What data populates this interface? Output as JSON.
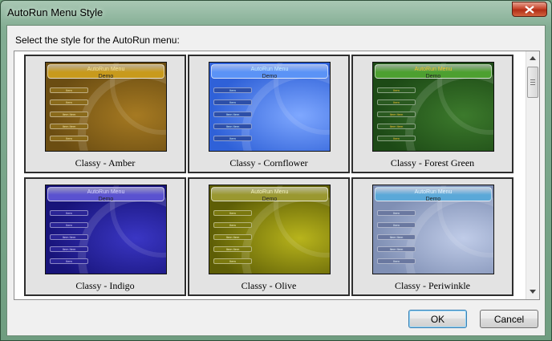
{
  "window": {
    "title": "AutoRun Menu Style"
  },
  "prompt": "Select the style for the AutoRun menu:",
  "preview": {
    "header_title": "AutoRun Menu",
    "header_sub": "Demo",
    "buttons": [
      "Item",
      "Item",
      "Item Item",
      "Item Item",
      "Item"
    ]
  },
  "styles": [
    {
      "caption": "Classy - Amber",
      "bg": "#6b4d12",
      "bg2": "#a67a22",
      "head": "#c89a1c",
      "head_text": "#f2e3a0",
      "btn": "#8a6a1a",
      "selected": false
    },
    {
      "caption": "Classy - Cornflower",
      "bg": "#2f61d8",
      "bg2": "#7fa8ff",
      "head": "#5b93f6",
      "head_text": "#c8f0ff",
      "btn": "#2d4fa8",
      "selected": false
    },
    {
      "caption": "Classy - Forest Green",
      "bg": "#1d4a16",
      "bg2": "#3c7a2c",
      "head": "#4da030",
      "head_text": "#f2c230",
      "btn": "#2a5a20",
      "selected": false
    },
    {
      "caption": "Classy - Indigo",
      "bg": "#18147a",
      "bg2": "#3a36c4",
      "head": "#5a52d0",
      "head_text": "#d8d4ff",
      "btn": "#2a2496",
      "selected": false
    },
    {
      "caption": "Classy - Olive",
      "bg": "#5e5e06",
      "bg2": "#b8b41c",
      "head": "#9a9830",
      "head_text": "#f4f2c0",
      "btn": "#7a780e",
      "selected": false
    },
    {
      "caption": "Classy - Periwinkle",
      "bg": "#7f8fb4",
      "bg2": "#c0cce8",
      "head": "#5aa8d8",
      "head_text": "#e8f6ff",
      "btn": "#6a78a0",
      "selected": false
    }
  ],
  "buttons": {
    "ok": "OK",
    "cancel": "Cancel"
  }
}
